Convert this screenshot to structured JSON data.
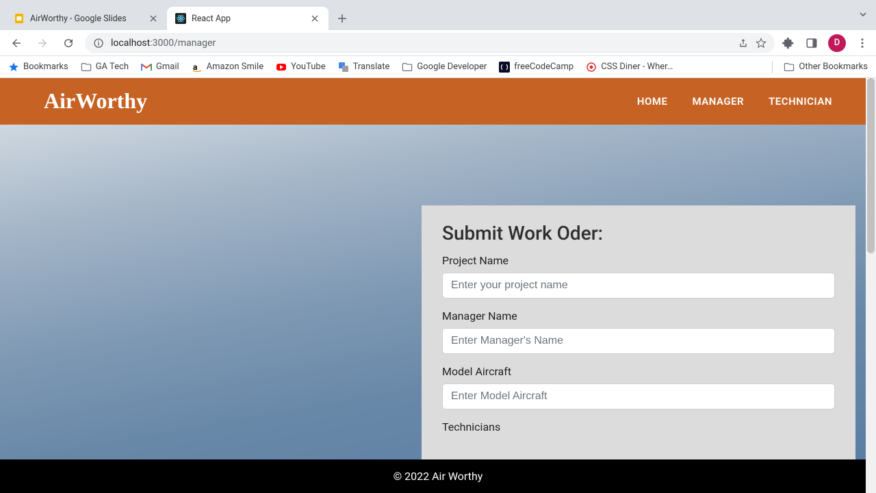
{
  "browser": {
    "tabs": [
      {
        "title": "AirWorthy - Google Slides",
        "active": false
      },
      {
        "title": "React App",
        "active": true
      }
    ],
    "url": {
      "host": "localhost",
      "port": ":3000",
      "path": "/manager"
    },
    "avatar_initial": "D",
    "bookmarks": [
      {
        "label": "Bookmarks",
        "icon": "star"
      },
      {
        "label": "GA Tech",
        "icon": "folder"
      },
      {
        "label": "Gmail",
        "icon": "gmail"
      },
      {
        "label": "Amazon Smile",
        "icon": "amazon"
      },
      {
        "label": "YouTube",
        "icon": "youtube"
      },
      {
        "label": "Translate",
        "icon": "translate"
      },
      {
        "label": "Google Developer",
        "icon": "folder"
      },
      {
        "label": "freeCodeCamp",
        "icon": "fcc"
      },
      {
        "label": "CSS Diner - Wher…",
        "icon": "cssdiner"
      }
    ],
    "bookmarks_overflow_icon": "»",
    "other_bookmarks_label": "Other Bookmarks"
  },
  "app": {
    "brand": "AirWorthy",
    "nav": [
      {
        "label": "HOME"
      },
      {
        "label": "MANAGER"
      },
      {
        "label": "TECHNICIAN"
      }
    ],
    "form": {
      "title": "Submit Work Oder:",
      "fields": [
        {
          "label": "Project Name",
          "placeholder": "Enter your project name",
          "name": "project-name-input"
        },
        {
          "label": "Manager Name",
          "placeholder": "Enter Manager's Name",
          "name": "manager-name-input"
        },
        {
          "label": "Model Aircraft",
          "placeholder": "Enter Model Aircraft",
          "name": "model-aircraft-input"
        },
        {
          "label": "Technicians",
          "placeholder": "",
          "name": "technicians-input"
        }
      ]
    },
    "footer": "© 2022 Air Worthy"
  }
}
